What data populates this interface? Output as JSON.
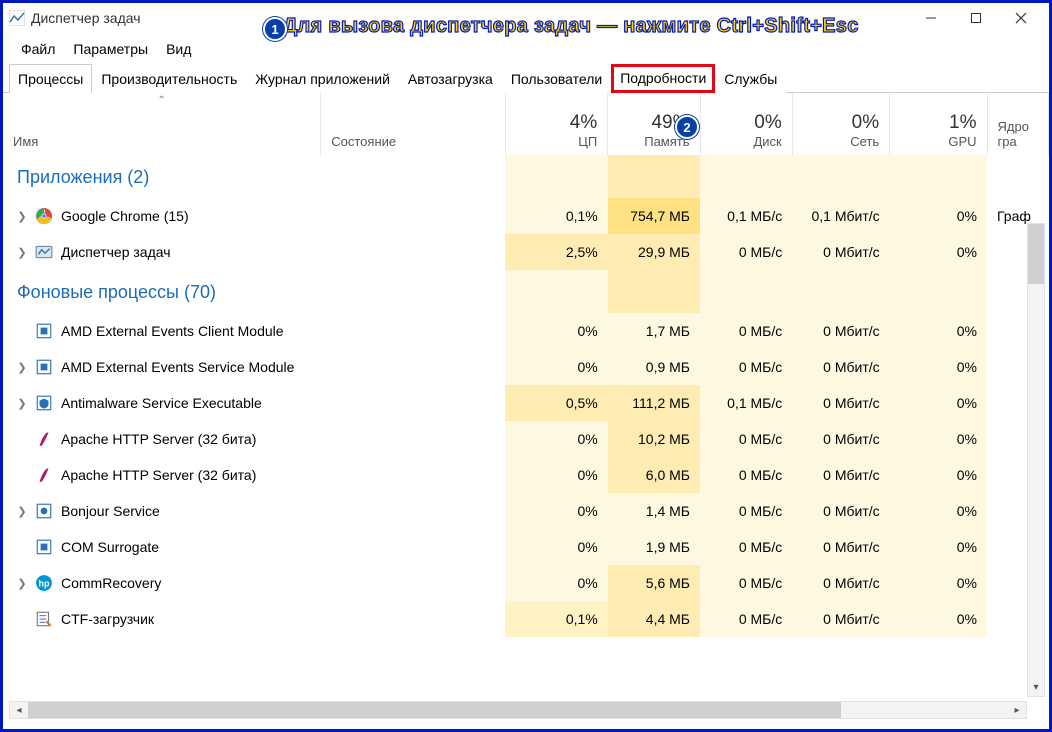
{
  "titlebar": {
    "title": "Диспетчер задач"
  },
  "overlay": {
    "text": "Для вызова диспетчера задач — нажмите Ctrl+Shift+Esc",
    "badge1": "1",
    "badge2": "2"
  },
  "menu": {
    "file": "Файл",
    "options": "Параметры",
    "view": "Вид"
  },
  "tabs": {
    "processes": "Процессы",
    "performance": "Производительность",
    "appHistory": "Журнал приложений",
    "startup": "Автозагрузка",
    "users": "Пользователи",
    "details": "Подробности",
    "services": "Службы"
  },
  "headers": {
    "name": "Имя",
    "state": "Состояние",
    "cpu": {
      "pct": "4%",
      "label": "ЦП"
    },
    "mem": {
      "pct": "49%",
      "label": "Память"
    },
    "disk": {
      "pct": "0%",
      "label": "Диск"
    },
    "net": {
      "pct": "0%",
      "label": "Сеть"
    },
    "gpu": {
      "pct": "1%",
      "label": "GPU"
    },
    "gpuEngine": "Ядро гра"
  },
  "groups": {
    "apps": "Приложения (2)",
    "bg": "Фоновые процессы (70)"
  },
  "rows": [
    {
      "grp": "apps",
      "exp": true,
      "icon": "chrome",
      "name": "Google Chrome (15)",
      "cpu": "0,1%",
      "hc": "heat-1",
      "mem": "754,7 МБ",
      "hm": "heat-3",
      "disk": "0,1 МБ/с",
      "hd": "heat-1",
      "net": "0,1 Мбит/с",
      "hn": "heat-1",
      "gpu": "0%",
      "hg": "heat-1",
      "ge": "Граф"
    },
    {
      "grp": "apps",
      "exp": true,
      "icon": "taskmgr",
      "name": "Диспетчер задач",
      "cpu": "2,5%",
      "hc": "heat-2",
      "mem": "29,9 МБ",
      "hm": "heat-2",
      "disk": "0 МБ/с",
      "hd": "heat-1",
      "net": "0 Мбит/с",
      "hn": "heat-1",
      "gpu": "0%",
      "hg": "heat-1",
      "ge": ""
    },
    {
      "grp": "bg",
      "exp": false,
      "icon": "amd",
      "name": "AMD External Events Client Module",
      "cpu": "0%",
      "hc": "heat-1",
      "mem": "1,7 МБ",
      "hm": "heat-1",
      "disk": "0 МБ/с",
      "hd": "heat-1",
      "net": "0 Мбит/с",
      "hn": "heat-1",
      "gpu": "0%",
      "hg": "heat-1",
      "ge": ""
    },
    {
      "grp": "bg",
      "exp": true,
      "icon": "amd",
      "name": "AMD External Events Service Module",
      "cpu": "0%",
      "hc": "heat-1",
      "mem": "0,9 МБ",
      "hm": "heat-1",
      "disk": "0 МБ/с",
      "hd": "heat-1",
      "net": "0 Мбит/с",
      "hn": "heat-1",
      "gpu": "0%",
      "hg": "heat-1",
      "ge": ""
    },
    {
      "grp": "bg",
      "exp": true,
      "icon": "defender",
      "name": "Antimalware Service Executable",
      "cpu": "0,5%",
      "hc": "heat-2",
      "mem": "111,2 МБ",
      "hm": "heat-2",
      "disk": "0,1 МБ/с",
      "hd": "heat-1",
      "net": "0 Мбит/с",
      "hn": "heat-1",
      "gpu": "0%",
      "hg": "heat-1",
      "ge": ""
    },
    {
      "grp": "bg",
      "exp": false,
      "icon": "apache",
      "name": "Apache HTTP Server (32 бита)",
      "cpu": "0%",
      "hc": "heat-1",
      "mem": "10,2 МБ",
      "hm": "heat-2",
      "disk": "0 МБ/с",
      "hd": "heat-1",
      "net": "0 Мбит/с",
      "hn": "heat-1",
      "gpu": "0%",
      "hg": "heat-1",
      "ge": ""
    },
    {
      "grp": "bg",
      "exp": false,
      "icon": "apache",
      "name": "Apache HTTP Server (32 бита)",
      "cpu": "0%",
      "hc": "heat-1",
      "mem": "6,0 МБ",
      "hm": "heat-2",
      "disk": "0 МБ/с",
      "hd": "heat-1",
      "net": "0 Мбит/с",
      "hn": "heat-1",
      "gpu": "0%",
      "hg": "heat-1",
      "ge": ""
    },
    {
      "grp": "bg",
      "exp": true,
      "icon": "bonjour",
      "name": "Bonjour Service",
      "cpu": "0%",
      "hc": "heat-1",
      "mem": "1,4 МБ",
      "hm": "heat-1",
      "disk": "0 МБ/с",
      "hd": "heat-1",
      "net": "0 Мбит/с",
      "hn": "heat-1",
      "gpu": "0%",
      "hg": "heat-1",
      "ge": ""
    },
    {
      "grp": "bg",
      "exp": false,
      "icon": "com",
      "name": "COM Surrogate",
      "cpu": "0%",
      "hc": "heat-1",
      "mem": "1,9 МБ",
      "hm": "heat-1",
      "disk": "0 МБ/с",
      "hd": "heat-1",
      "net": "0 Мбит/с",
      "hn": "heat-1",
      "gpu": "0%",
      "hg": "heat-1",
      "ge": ""
    },
    {
      "grp": "bg",
      "exp": true,
      "icon": "hp",
      "name": "CommRecovery",
      "cpu": "0%",
      "hc": "heat-1",
      "mem": "5,6 МБ",
      "hm": "heat-2",
      "disk": "0 МБ/с",
      "hd": "heat-1",
      "net": "0 Мбит/с",
      "hn": "heat-1",
      "gpu": "0%",
      "hg": "heat-1",
      "ge": ""
    },
    {
      "grp": "bg",
      "exp": false,
      "icon": "ctf",
      "name": "CTF-загрузчик",
      "cpu": "0,1%",
      "hc": "heat-4",
      "mem": "4,4 МБ",
      "hm": "heat-2",
      "disk": "0 МБ/с",
      "hd": "heat-1",
      "net": "0 Мбит/с",
      "hn": "heat-1",
      "gpu": "0%",
      "hg": "heat-1",
      "ge": ""
    }
  ]
}
